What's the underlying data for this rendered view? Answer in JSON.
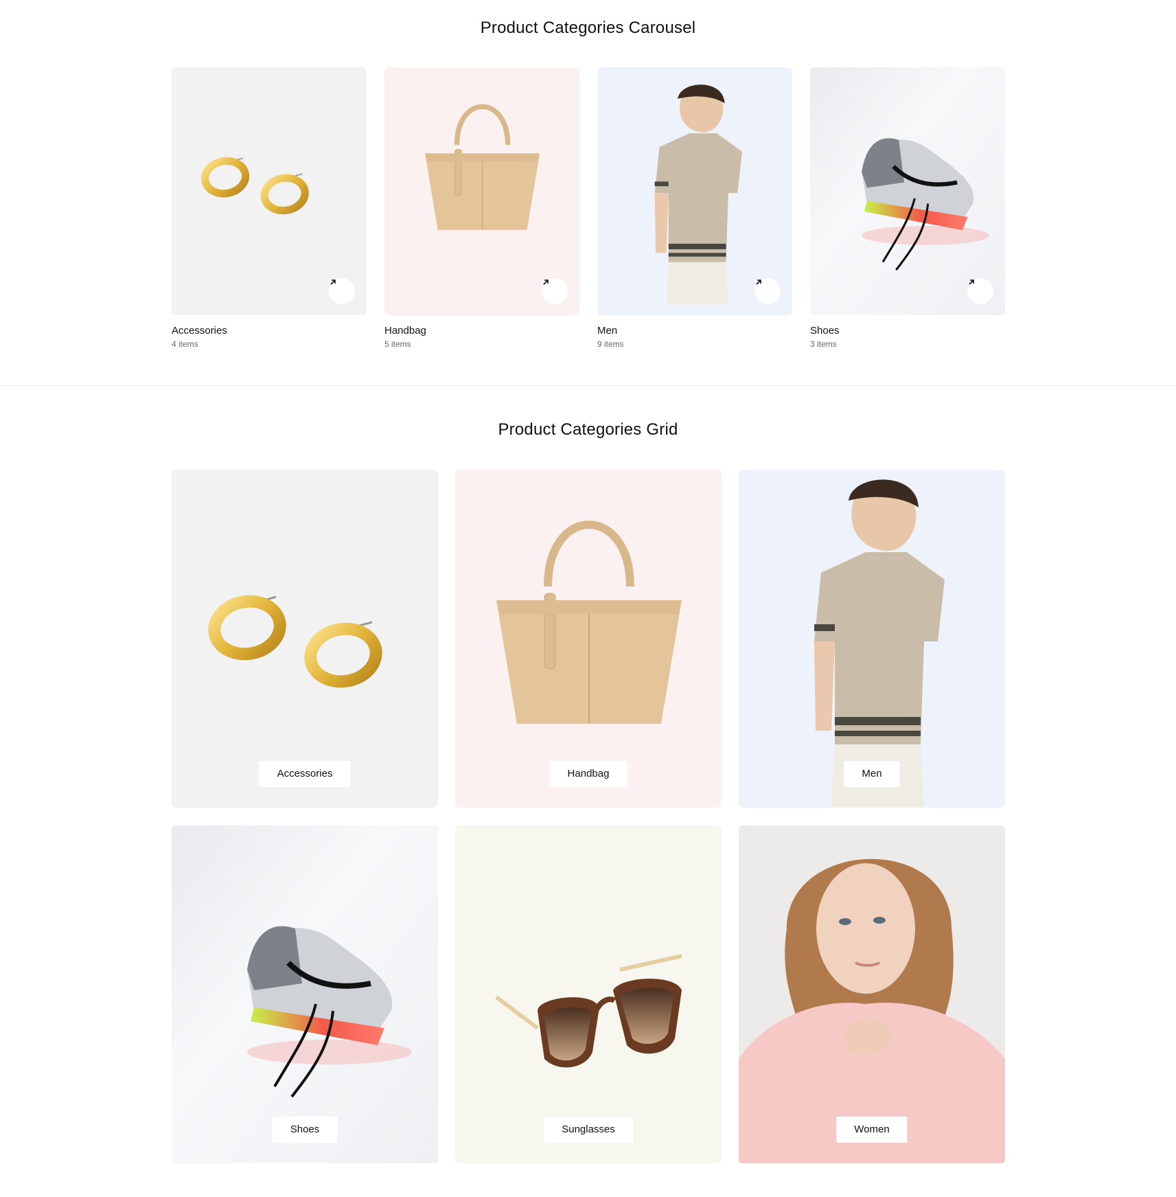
{
  "carousel": {
    "title": "Product Categories Carousel",
    "cards": [
      {
        "name": "Accessories",
        "count": "4 items",
        "bg": "#f2f2f2",
        "icon": "earrings-image"
      },
      {
        "name": "Handbag",
        "count": "5 items",
        "bg": "#fbf1f0",
        "icon": "handbag-image"
      },
      {
        "name": "Men",
        "count": "9 items",
        "bg": "#eef3fb",
        "icon": "men-model-image"
      },
      {
        "name": "Shoes",
        "count": "3 items",
        "bg": "#f4f5f7",
        "icon": "sneaker-image"
      }
    ]
  },
  "grid": {
    "title": "Product Categories Grid",
    "cards": [
      {
        "name": "Accessories",
        "bg": "#f2f2f2",
        "icon": "earrings-image"
      },
      {
        "name": "Handbag",
        "bg": "#fbf1f0",
        "icon": "handbag-image"
      },
      {
        "name": "Men",
        "bg": "#eef3fb",
        "icon": "men-model-image"
      },
      {
        "name": "Shoes",
        "bg": "#f4f5f7",
        "icon": "sneaker-image"
      },
      {
        "name": "Sunglasses",
        "bg": "#f7f6ef",
        "icon": "sunglasses-image"
      },
      {
        "name": "Women",
        "bg": "#ecebe9",
        "icon": "women-model-image"
      }
    ]
  }
}
